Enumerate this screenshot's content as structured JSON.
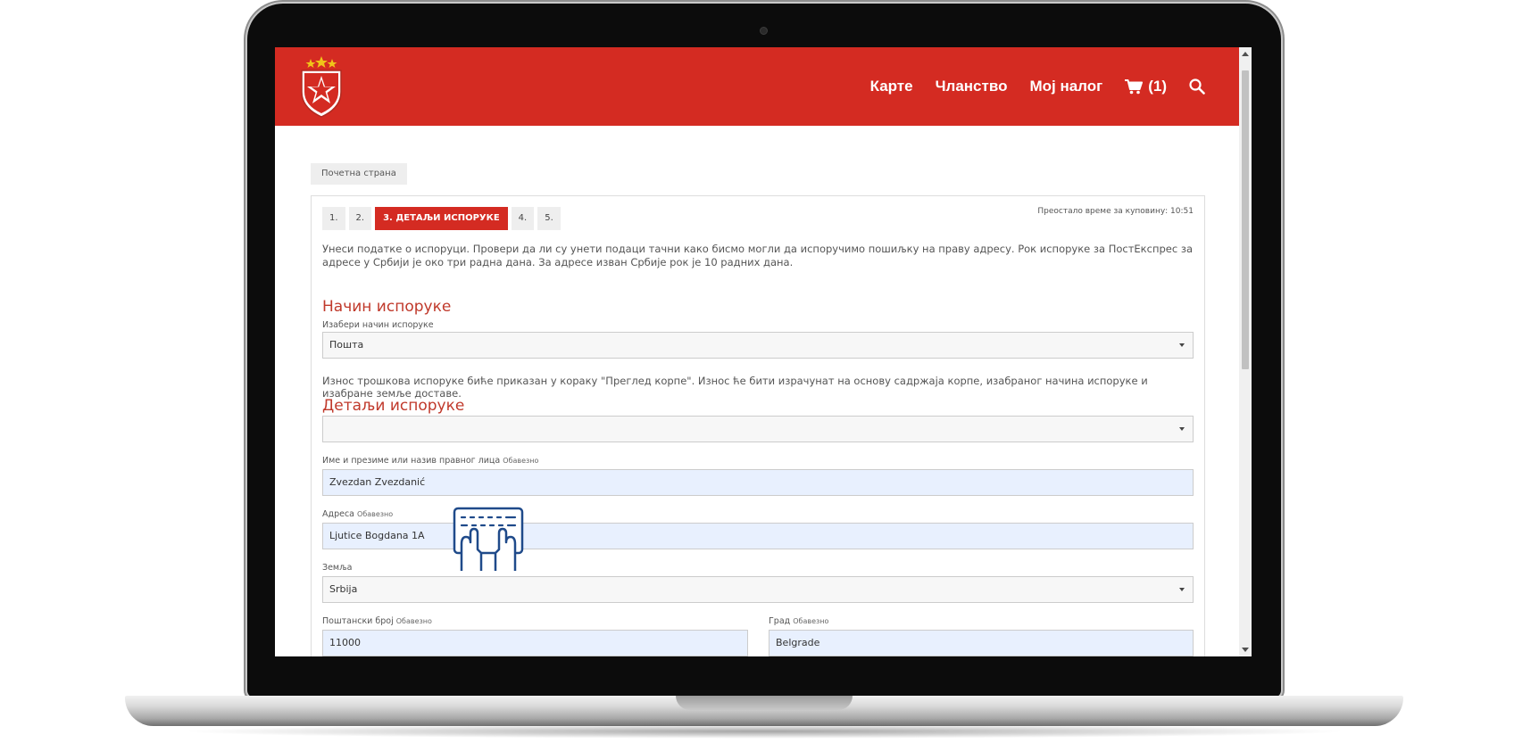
{
  "header": {
    "nav": [
      "Карте",
      "Чланство",
      "Мој налог"
    ],
    "cart_count": "(1)",
    "brand_color": "#d42b22",
    "icons": {
      "cart": "shopping-cart-icon",
      "search": "search-icon"
    }
  },
  "breadcrumb": "Почетна страна",
  "checkout": {
    "steps": [
      "1.",
      "2.",
      "3. ДЕТАЉИ ИСПОРУКЕ",
      "4.",
      "5."
    ],
    "active_step": 3,
    "timer": "Преостало време за куповину: 10:51",
    "intro": "Унеси податке о испоруци. Провери да ли су унети подаци тачни како бисмо могли да испоручимо пошиљку на праву адресу. Рок испоруке за ПостЕкспрес за адресе у Србији је око три радна дана. За адресе изван Србије рок је 10 радних дана.",
    "delivery_method": {
      "title": "Начин испоруке",
      "label": "Изабери начин испоруке",
      "value": "Пошта"
    },
    "shipping_note": "Износ трошкова испоруке биће приказан у кораку \"Преглед корпе\". Износ ће бити израчунат на основу садржаја корпе, изабраног начина испоруке и изабране земље доставе.",
    "details": {
      "title": "Детаљи испоруке",
      "saved_address_value": "",
      "required": "Обавезно",
      "name_label": "Име и презиме или назив правног лица",
      "name_value": "Zvezdan Zvezdanić",
      "address_label": "Адреса",
      "address_value": "Ljutice Bogdana 1A",
      "country_label": "Земља",
      "country_value": "Srbija",
      "postal_label": "Поштански број",
      "postal_value": "11000",
      "city_label": "Град",
      "city_value": "Belgrade"
    }
  },
  "overlay_icon": "keyboard-typing-icon"
}
